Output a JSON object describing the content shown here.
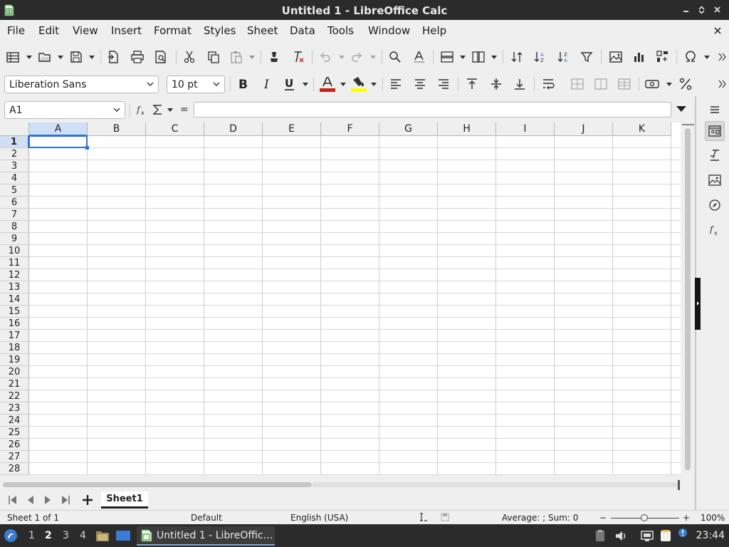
{
  "window": {
    "title": "Untitled 1 - LibreOffice Calc"
  },
  "menu": [
    "File",
    "Edit",
    "View",
    "Insert",
    "Format",
    "Styles",
    "Sheet",
    "Data",
    "Tools",
    "Window",
    "Help"
  ],
  "formatting": {
    "font_name": "Liberation Sans",
    "font_size": "10 pt"
  },
  "formula_bar": {
    "name_box": "A1",
    "function_wizard_icon": "fx-icon",
    "sum_icon": "sigma-icon",
    "equals": "=",
    "input": ""
  },
  "columns": [
    "A",
    "B",
    "C",
    "D",
    "E",
    "F",
    "G",
    "H",
    "I",
    "J",
    "K"
  ],
  "rows": [
    "1",
    "2",
    "3",
    "4",
    "5",
    "6",
    "7",
    "8",
    "9",
    "10",
    "11",
    "12",
    "13",
    "14",
    "15",
    "16",
    "17",
    "18",
    "19",
    "20",
    "21",
    "22",
    "23",
    "24",
    "25",
    "26",
    "27",
    "28"
  ],
  "selected_cell": "A1",
  "sheet_tabs": [
    {
      "label": "Sheet1",
      "active": true
    }
  ],
  "statusbar": {
    "sheet": "Sheet 1 of 1",
    "page_style": "Default",
    "language": "English (USA)",
    "summary": "Average: ; Sum: 0",
    "zoom": "100%",
    "zoom_minus": "−",
    "zoom_plus": "+"
  },
  "taskbar": {
    "workspaces": [
      "1",
      "2",
      "3",
      "4"
    ],
    "active_workspace": "2",
    "task_label": "Untitled 1 - LibreOffic…",
    "clock": "23:44"
  },
  "colors": {
    "accent": "#2d74d6",
    "selection_header": "#cfe0f4",
    "font_color": "#c9211e",
    "highlight_color": "#ffff00"
  }
}
